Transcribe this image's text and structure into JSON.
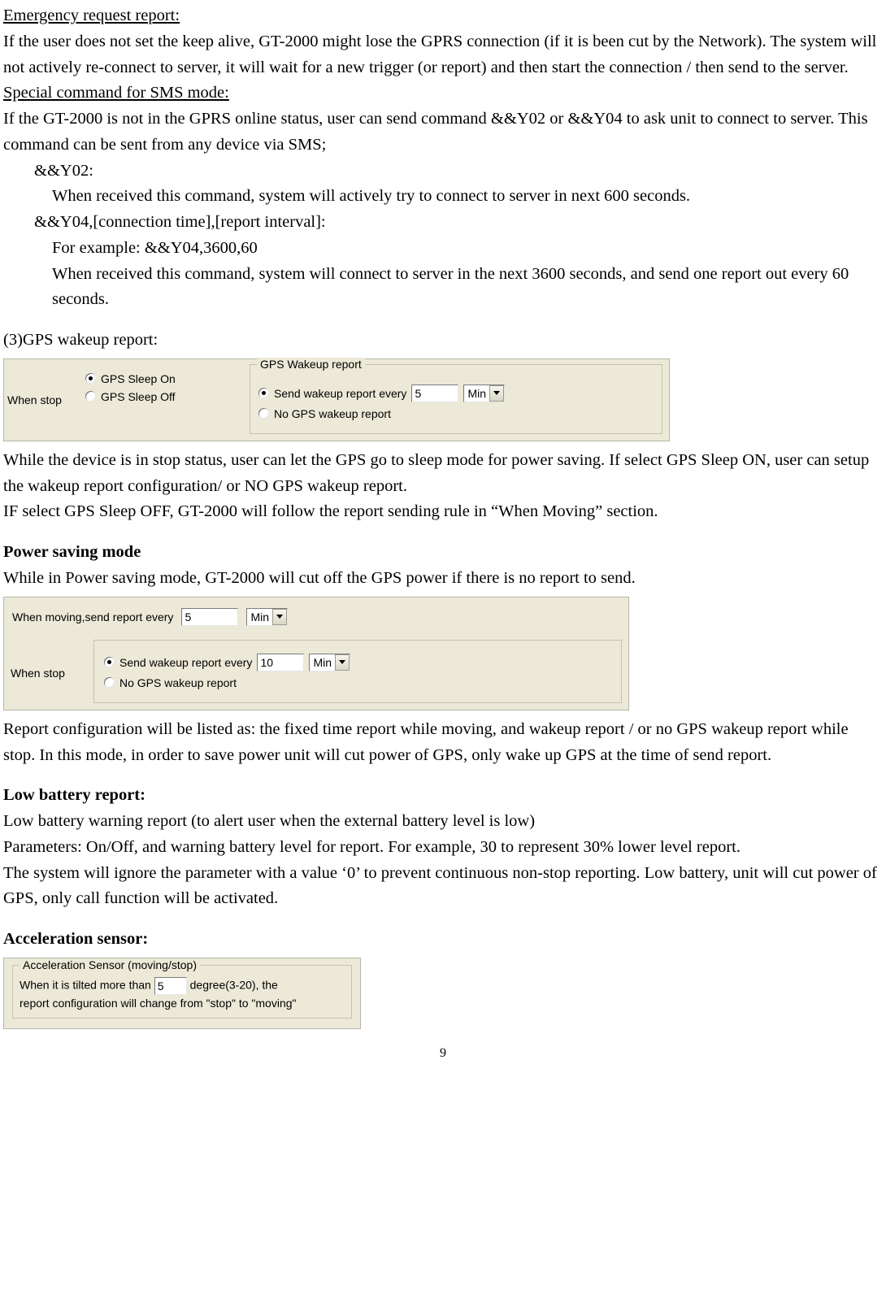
{
  "headings": {
    "emergency": "Emergency request report:",
    "special_sms": "Special command for SMS mode:",
    "gps_wakeup": "(3)GPS wakeup report:",
    "power_saving": "Power saving mode",
    "low_battery": "Low battery report:",
    "accel_sensor": "Acceleration sensor:"
  },
  "body": {
    "emergency_p": "If the user does not set the keep alive, GT-2000 might lose the GPRS connection (if it is been cut by the Network). The system will not actively re-connect to server, it will wait for a new trigger (or report) and then start the connection / then send to the server.",
    "special_p": "If the GT-2000 is not in the GPRS online status, user can send command &&Y02 or &&Y04 to ask unit to connect to server. This command can be sent from any device via SMS;",
    "y02_head": "&&Y02:",
    "y02_body": "When received this command, system will actively try to connect to server in next 600 seconds.",
    "y04_head": "&&Y04,[connection time],[report interval]:",
    "y04_ex": "For example: &&Y04,3600,60",
    "y04_body": "When received this command, system will connect to server in the next 3600 seconds, and send one report out every 60 seconds.",
    "gps_wakeup_p1": "While the device is in stop status, user can let the GPS go to sleep mode for power saving. If select GPS Sleep ON, user can setup the wakeup report configuration/ or NO GPS wakeup report.",
    "gps_wakeup_p2": "IF select GPS Sleep OFF, GT-2000 will follow the report sending rule in “When Moving” section.",
    "power_saving_p": "While in Power saving mode, GT-2000 will cut off the GPS power if there is no report to send.",
    "power_saving_p2": "Report configuration will be listed as: the fixed time report while moving, and wakeup report / or no GPS wakeup report while stop. In this mode, in order to save power unit will cut power of GPS, only wake up GPS at the time of send report.",
    "low_batt_p1": "Low battery warning report (to alert user when the external battery level is low)",
    "low_batt_p2": "Parameters: On/Off, and warning battery level for report. For example, 30 to represent 30% lower level report.",
    "low_batt_p3": "The system will ignore the parameter with a value ‘0’ to prevent continuous non-stop reporting. Low battery, unit will cut power of GPS, only call function will be activated."
  },
  "ui1": {
    "when_stop": "When stop",
    "sleep_on": "GPS Sleep On",
    "sleep_off": "GPS Sleep Off",
    "group_title": "GPS Wakeup report",
    "send_every": "Send wakeup report every",
    "no_report": "No GPS wakeup report",
    "interval_value": "5",
    "unit": "Min"
  },
  "ui2": {
    "moving_label": "When moving,send report every",
    "moving_value": "5",
    "moving_unit": "Min",
    "when_stop": "When stop",
    "send_every": "Send wakeup report every",
    "stop_value": "10",
    "stop_unit": "Min",
    "no_report": "No GPS wakeup report"
  },
  "ui3": {
    "group_title": "Acceleration Sensor (moving/stop)",
    "line1a": "When it is tilted more than",
    "degree_value": "5",
    "line1b": "degree(3-20),  the",
    "line2": "report configuration will change from \"stop\" to \"moving\""
  },
  "page_number": "9"
}
